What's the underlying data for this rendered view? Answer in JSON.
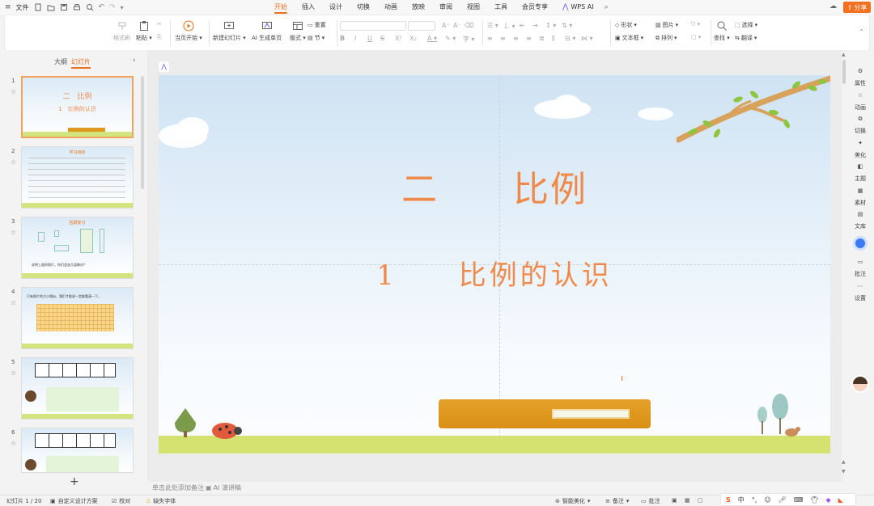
{
  "menu": {
    "file": "文件",
    "tabs": [
      "开始",
      "插入",
      "设计",
      "切换",
      "动画",
      "放映",
      "审阅",
      "视图",
      "工具",
      "会员专享"
    ],
    "active_tab": "开始",
    "wps_ai": "WPS AI",
    "share": "分享"
  },
  "ribbon": {
    "format_painter": "格式刷",
    "paste": "粘贴",
    "play_from_current": "当页开始",
    "new_slide": "新建幻灯片",
    "ai_generate": "AI 生成单页",
    "layout": "版式",
    "reset": "重置",
    "section": "节",
    "shape": "形状",
    "picture": "图片",
    "textbox": "文本框",
    "arrange": "排列",
    "find": "查找",
    "select": "选择",
    "replace": "翻译"
  },
  "left_panel": {
    "tab_outline": "大纲",
    "tab_slides": "幻灯片",
    "thumbnails": [
      {
        "num": "1",
        "title": "二　比例",
        "sub": "1　比例的认识"
      },
      {
        "num": "2",
        "title": "学习目标"
      },
      {
        "num": "3",
        "title": "回顾复习",
        "text": "说明上面的照片，你们会选几组做对？"
      },
      {
        "num": "4",
        "text": "只有照片的大小相似，我们才能说一定能看清一下。"
      },
      {
        "num": "5"
      },
      {
        "num": "6"
      }
    ]
  },
  "slide": {
    "title": "二　　比例",
    "subtitle": "1　　比例的认识"
  },
  "right_sidebar": [
    "属性",
    "动画",
    "切换",
    "美化",
    "主题",
    "素材",
    "文库",
    "批注",
    "设置"
  ],
  "notes": {
    "placeholder": "单击此处添加备注",
    "ai_notes": "AI 演讲稿"
  },
  "status": {
    "slide_counter": "幻灯片 1 / 20",
    "custom_design": "自定义设计方案",
    "proofread": "校对",
    "missing_font": "缺失字体",
    "smart_beautify": "智能美化",
    "notes": "备注",
    "comments": "批注"
  },
  "colors": {
    "accent": "#e8711d",
    "title": "#f08a4b",
    "ground": "#d4e36f",
    "bar": "#dd9a1f"
  }
}
